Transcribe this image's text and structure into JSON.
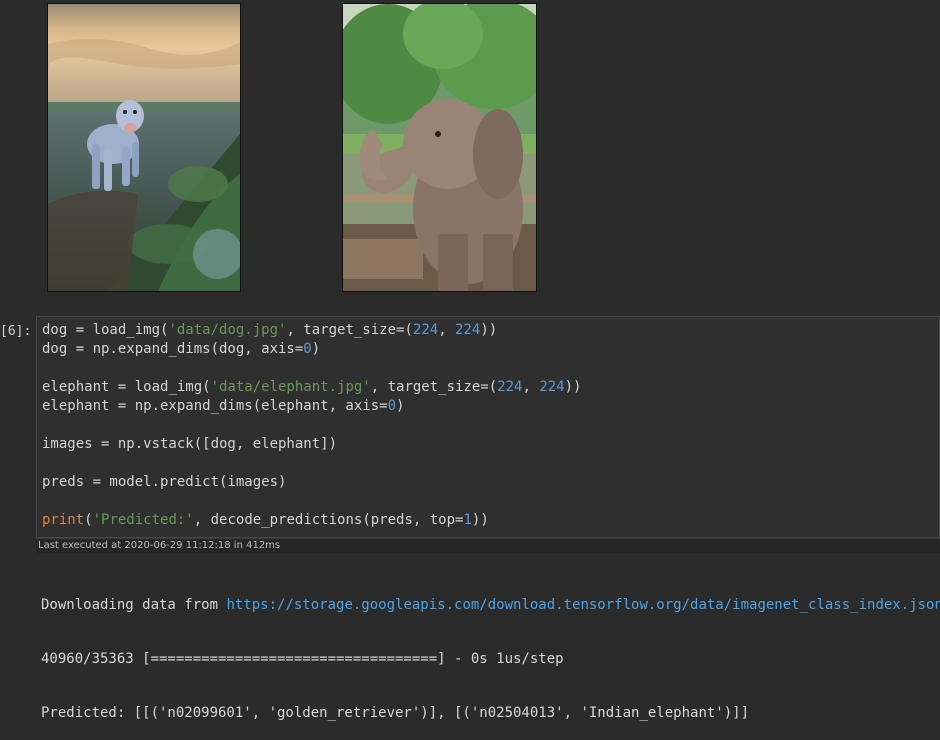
{
  "output_images": [
    {
      "name": "dog photo",
      "subject": "golden retriever in field at sunset"
    },
    {
      "name": "elephant photo",
      "subject": "Indian elephant raising trunk"
    }
  ],
  "cell": {
    "prompt": "[6]:",
    "code_lines": [
      [
        {
          "t": "dog = load_img(",
          "c": "plain"
        },
        {
          "t": "'data/dog.jpg'",
          "c": "str"
        },
        {
          "t": ", target_size=(",
          "c": "plain"
        },
        {
          "t": "224",
          "c": "num"
        },
        {
          "t": ", ",
          "c": "plain"
        },
        {
          "t": "224",
          "c": "num"
        },
        {
          "t": "))",
          "c": "plain"
        }
      ],
      [
        {
          "t": "dog = np.expand_dims(dog, axis=",
          "c": "plain"
        },
        {
          "t": "0",
          "c": "num"
        },
        {
          "t": ")",
          "c": "plain"
        }
      ],
      [],
      [
        {
          "t": "elephant = load_img(",
          "c": "plain"
        },
        {
          "t": "'data/elephant.jpg'",
          "c": "str"
        },
        {
          "t": ", target_size=(",
          "c": "plain"
        },
        {
          "t": "224",
          "c": "num"
        },
        {
          "t": ", ",
          "c": "plain"
        },
        {
          "t": "224",
          "c": "num"
        },
        {
          "t": "))",
          "c": "plain"
        }
      ],
      [
        {
          "t": "elephant = np.expand_dims(elephant, axis=",
          "c": "plain"
        },
        {
          "t": "0",
          "c": "num"
        },
        {
          "t": ")",
          "c": "plain"
        }
      ],
      [],
      [
        {
          "t": "images = np.vstack([dog, elephant])",
          "c": "plain"
        }
      ],
      [],
      [
        {
          "t": "preds = model.predict(images)",
          "c": "plain"
        }
      ],
      [],
      [
        {
          "t": "print",
          "c": "kw"
        },
        {
          "t": "(",
          "c": "plain"
        },
        {
          "t": "'Predicted:'",
          "c": "str"
        },
        {
          "t": ", decode_predictions(preds, top=",
          "c": "plain"
        },
        {
          "t": "1",
          "c": "num"
        },
        {
          "t": "))",
          "c": "plain"
        }
      ]
    ],
    "exec_status": "Last executed at 2020-06-29 11:12:18 in 412ms"
  },
  "output": {
    "download_prefix": "Downloading data from ",
    "download_url": "https://storage.googleapis.com/download.tensorflow.org/data/imagenet_class_index.json",
    "progress": "40960/35363 [==================================] - 0s 1us/step",
    "predicted": "Predicted: [[('n02099601', 'golden_retriever')], [('n02504013', 'Indian_elephant')]]"
  },
  "colors": {
    "background": "#2b2b2b",
    "string": "#6a9955",
    "number": "#5b9bd5",
    "keyword": "#e6803a",
    "link": "#4ea3e6"
  }
}
